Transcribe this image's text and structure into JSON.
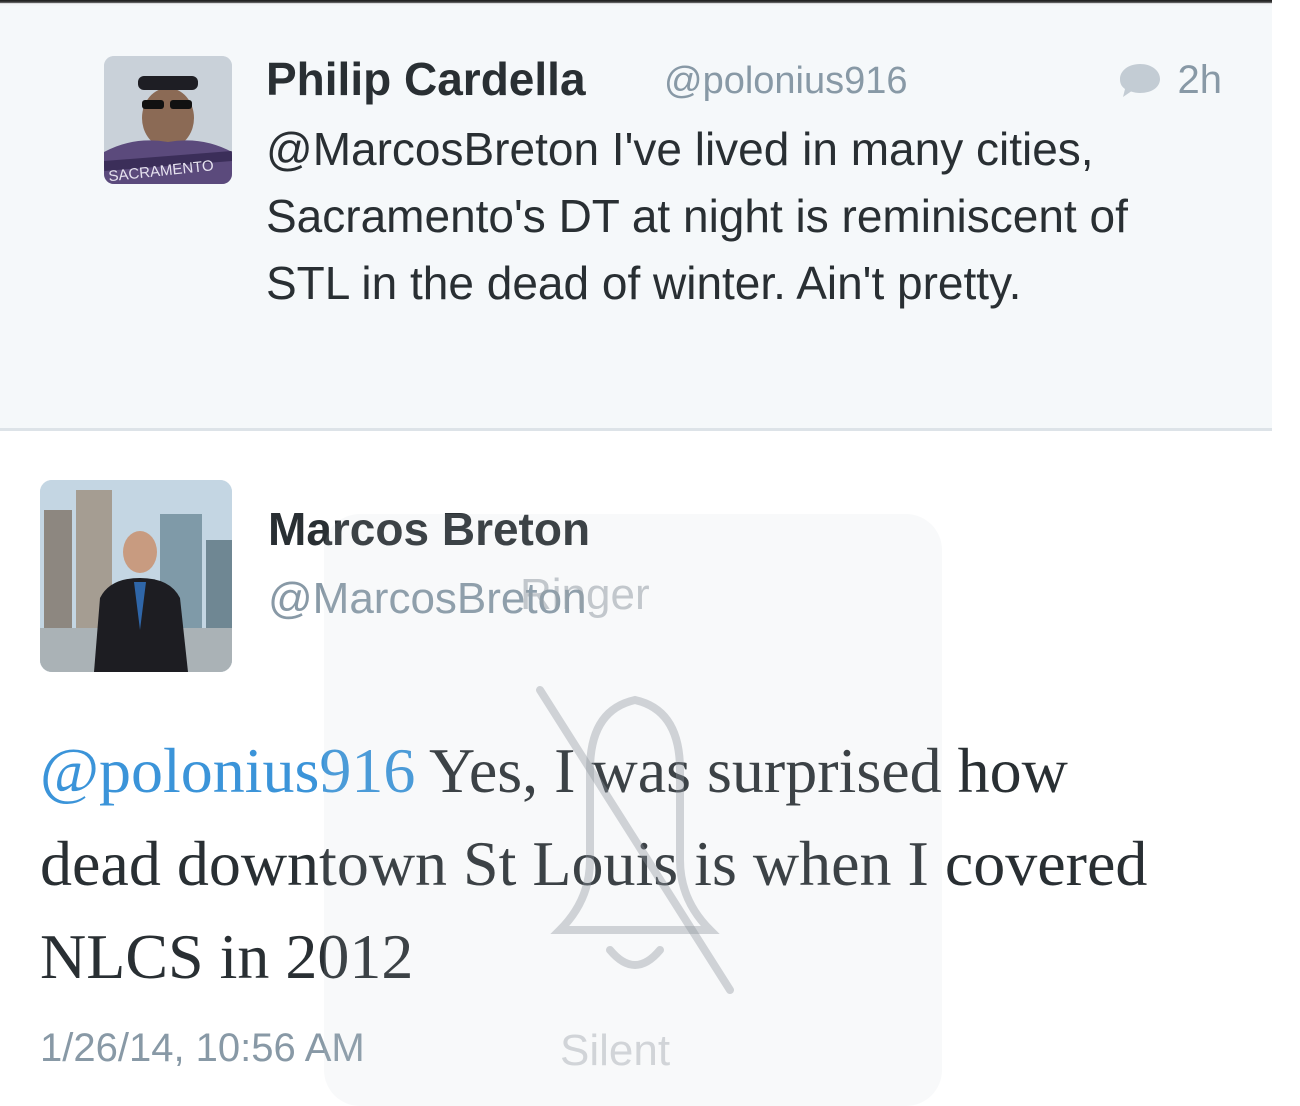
{
  "tweets": [
    {
      "author_name": "Philip Cardella",
      "handle": "@polonius916",
      "relative_time": "2h",
      "avatar_icon": "user-avatar-icon",
      "avatar_shirt_text": "SACRAMENTO",
      "text": "@MarcosBreton I've lived in many cities, Sacramento's DT at night is reminiscent of STL in the dead of winter. Ain't pretty."
    },
    {
      "author_name": "Marcos Breton",
      "handle": "@MarcosBreton",
      "avatar_icon": "user-avatar-icon",
      "mention": "@polonius916",
      "text": " Yes, I was surprised how dead downtown St Louis is when I covered NLCS in 2012",
      "timestamp": "1/26/14, 10:56 AM"
    }
  ],
  "ringer_overlay": {
    "title": "Ringer",
    "status": "Silent",
    "icon": "bell-muted-icon"
  },
  "colors": {
    "link": "#3b94d9",
    "meta": "#8899a6",
    "text": "#292f33",
    "reply_background": "#f5f8fa"
  }
}
